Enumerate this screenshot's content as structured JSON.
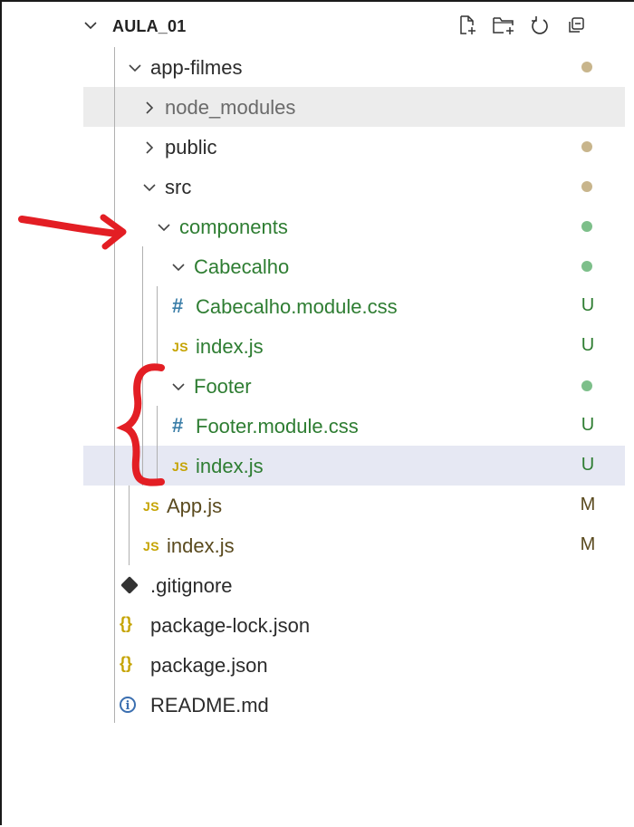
{
  "explorer": {
    "title": "AULA_01"
  },
  "colors": {
    "modified_dot": "#c8b58c",
    "untracked_dot": "#7dbf8a",
    "untracked_text": "#2e7d32",
    "modified_text": "#5a4a1e",
    "annotation": "#e31e24",
    "selected_row": "#e6e8f3",
    "ignored_row": "#ececec"
  },
  "tree": [
    {
      "label": "app-filmes",
      "type": "folder",
      "expanded": true,
      "status": "dot-modified"
    },
    {
      "label": "node_modules",
      "type": "folder",
      "expanded": false,
      "status": "ignored"
    },
    {
      "label": "public",
      "type": "folder",
      "expanded": false,
      "status": "dot-modified"
    },
    {
      "label": "src",
      "type": "folder",
      "expanded": true,
      "status": "dot-modified"
    },
    {
      "label": "components",
      "type": "folder",
      "expanded": true,
      "status": "dot-untracked"
    },
    {
      "label": "Cabecalho",
      "type": "folder",
      "expanded": true,
      "status": "dot-untracked"
    },
    {
      "label": "Cabecalho.module.css",
      "type": "css-file",
      "status": "U"
    },
    {
      "label": "index.js",
      "type": "js-file",
      "status": "U"
    },
    {
      "label": "Footer",
      "type": "folder",
      "expanded": true,
      "status": "dot-untracked"
    },
    {
      "label": "Footer.module.css",
      "type": "css-file",
      "status": "U"
    },
    {
      "label": "index.js",
      "type": "js-file",
      "status": "U",
      "selected": true
    },
    {
      "label": "App.js",
      "type": "js-file",
      "status": "M"
    },
    {
      "label": "index.js",
      "type": "js-file",
      "status": "M"
    },
    {
      "label": ".gitignore",
      "type": "git-file",
      "status": ""
    },
    {
      "label": "package-lock.json",
      "type": "json-file",
      "status": ""
    },
    {
      "label": "package.json",
      "type": "json-file",
      "status": ""
    },
    {
      "label": "README.md",
      "type": "info-file",
      "status": ""
    }
  ],
  "icons": {
    "js": "JS",
    "css": "#",
    "json": "{}",
    "info": "i"
  }
}
